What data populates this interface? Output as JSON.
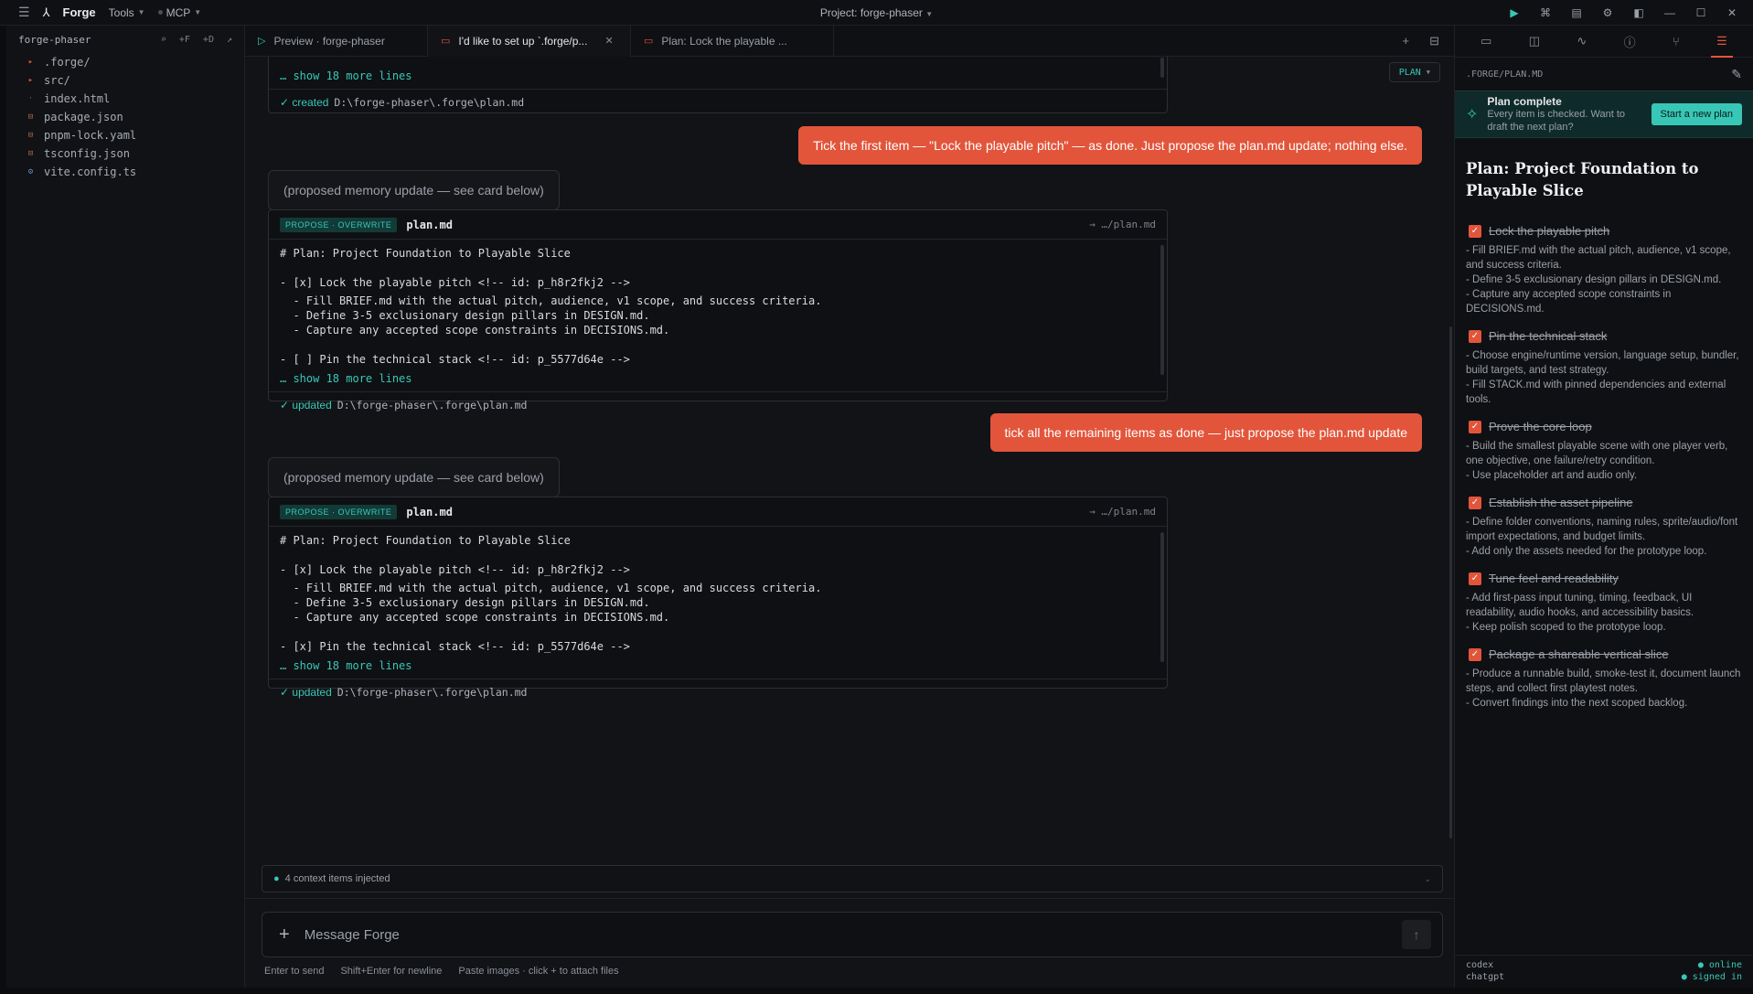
{
  "titlebar": {
    "app_name": "Forge",
    "menu_tools": "Tools",
    "menu_mcp": "MCP",
    "project_title": "Project: forge-phaser",
    "accent": "#38c7b7"
  },
  "files": {
    "root": "forge-phaser",
    "actions": [
      "⌕",
      "+F",
      "+D",
      "↗"
    ],
    "items": [
      {
        "name": ".forge/",
        "icon": "folder-icon"
      },
      {
        "name": "src/",
        "icon": "folder-icon"
      },
      {
        "name": "index.html",
        "icon": "file-dot-icon"
      },
      {
        "name": "package.json",
        "icon": "package-icon"
      },
      {
        "name": "pnpm-lock.yaml",
        "icon": "package-icon"
      },
      {
        "name": "tsconfig.json",
        "icon": "package-icon"
      },
      {
        "name": "vite.config.ts",
        "icon": "gear-icon"
      }
    ]
  },
  "tabs": [
    {
      "label": "Preview · forge-phaser"
    },
    {
      "label": "I'd like to set up `.forge/p..."
    },
    {
      "label": "Plan: Lock the playable ..."
    }
  ],
  "chat": {
    "mode_pill": "PLAN",
    "card0": {
      "more": "… show 18 more lines",
      "status": "✓ created",
      "path": "D:\\forge-phaser\\.forge\\plan.md"
    },
    "user1": "Tick the first item — \"Lock the playable pitch\" — as done. Just propose the plan.md update; nothing else.",
    "memory1": "(proposed memory update — see card below)",
    "card1": {
      "badge": "PROPOSE · OVERWRITE",
      "file": "plan.md",
      "target": "→ …/plan.md",
      "lines": [
        "# Plan: Project Foundation to Playable Slice",
        "",
        "- [x] Lock the playable pitch <!-- id: p_h8r2fkj2 -->",
        "  - Fill BRIEF.md with the actual pitch, audience, v1 scope, and success criteria.",
        "  - Define 3-5 exclusionary design pillars in DESIGN.md.",
        "  - Capture any accepted scope constraints in DECISIONS.md.",
        "",
        "- [ ] Pin the technical stack <!-- id: p_5577d64e -->"
      ],
      "more": "… show 18 more lines",
      "status": "✓ updated",
      "path": "D:\\forge-phaser\\.forge\\plan.md"
    },
    "user2": "tick all the remaining items as done — just propose the plan.md update",
    "memory2": "(proposed memory update — see card below)",
    "card2": {
      "badge": "PROPOSE · OVERWRITE",
      "file": "plan.md",
      "target": "→ …/plan.md",
      "lines": [
        "# Plan: Project Foundation to Playable Slice",
        "",
        "- [x] Lock the playable pitch <!-- id: p_h8r2fkj2 -->",
        "  - Fill BRIEF.md with the actual pitch, audience, v1 scope, and success criteria.",
        "  - Define 3-5 exclusionary design pillars in DESIGN.md.",
        "  - Capture any accepted scope constraints in DECISIONS.md.",
        "",
        "- [x] Pin the technical stack <!-- id: p_5577d64e -->"
      ],
      "more": "… show 18 more lines",
      "status": "✓ updated",
      "path": "D:\\forge-phaser\\.forge\\plan.md"
    },
    "context": "4 context items injected"
  },
  "composer": {
    "placeholder": "Message Forge",
    "hints": [
      "Enter to send",
      "Shift+Enter for newline",
      "Paste images · click + to attach files"
    ]
  },
  "rightpanel": {
    "path": ".FORGE/PLAN.MD",
    "banner": {
      "title": "Plan complete",
      "text": "Every item is checked. Want to draft the next plan?",
      "button": "Start a new plan"
    },
    "title": "Plan: Project Foundation to Playable Slice",
    "items": [
      {
        "label": "Lock the playable pitch",
        "checked": true,
        "desc": [
          "- Fill BRIEF.md with the actual pitch, audience, v1 scope, and success criteria.",
          "- Define 3-5 exclusionary design pillars in DESIGN.md.",
          "- Capture any accepted scope constraints in DECISIONS.md."
        ]
      },
      {
        "label": "Pin the technical stack",
        "checked": true,
        "desc": [
          "- Choose engine/runtime version, language setup, bundler, build targets, and test strategy.",
          "- Fill STACK.md with pinned dependencies and external tools."
        ]
      },
      {
        "label": "Prove the core loop",
        "checked": true,
        "desc": [
          "- Build the smallest playable scene with one player verb, one objective, one failure/retry condition.",
          "- Use placeholder art and audio only."
        ]
      },
      {
        "label": "Establish the asset pipeline",
        "checked": true,
        "desc": [
          "- Define folder conventions, naming rules, sprite/audio/font import expectations, and budget limits.",
          "- Add only the assets needed for the prototype loop."
        ]
      },
      {
        "label": "Tune feel and readability",
        "checked": true,
        "desc": [
          "- Add first-pass input tuning, timing, feedback, UI readability, audio hooks, and accessibility basics.",
          "- Keep polish scoped to the prototype loop."
        ]
      },
      {
        "label": "Package a shareable vertical slice",
        "checked": true,
        "desc": [
          "- Produce a runnable build, smoke-test it, document launch steps, and collect first playtest notes.",
          "- Convert findings into the next scoped backlog."
        ]
      }
    ],
    "footer": {
      "left1": "codex",
      "left2": "chatgpt",
      "right1": "● online",
      "right2": "● signed in"
    }
  }
}
